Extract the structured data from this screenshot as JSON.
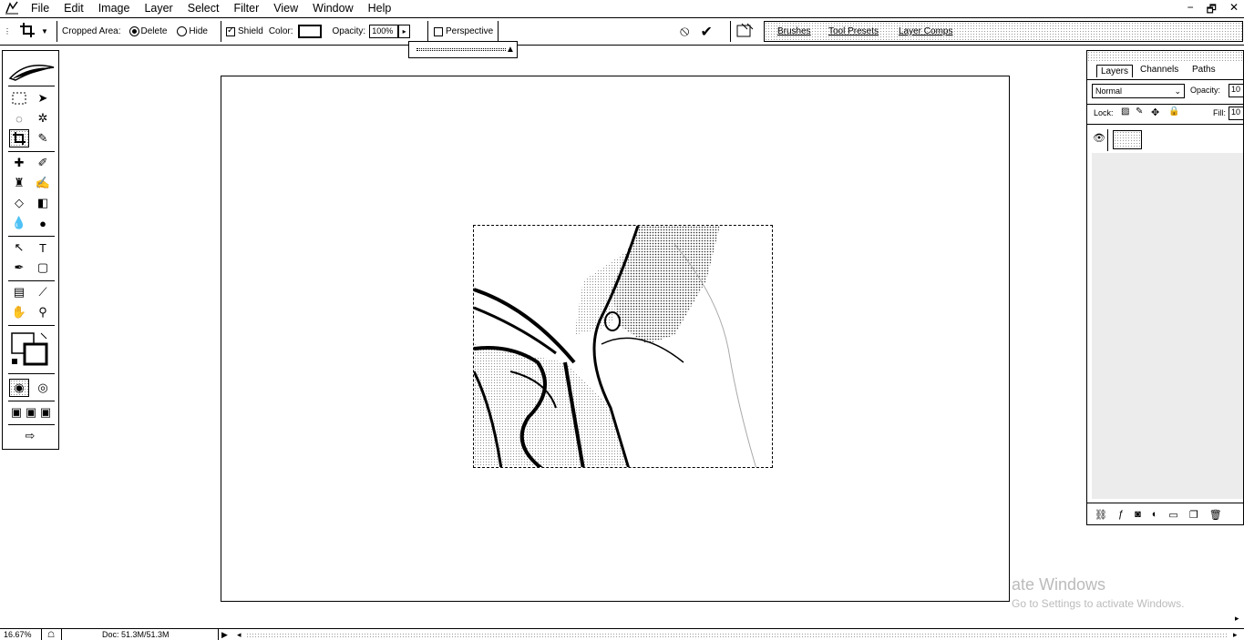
{
  "menubar": {
    "items": [
      "File",
      "Edit",
      "Image",
      "Layer",
      "Select",
      "Filter",
      "View",
      "Window",
      "Help"
    ],
    "window_controls": {
      "minimize": "−",
      "restore": "🗗",
      "close": "✕"
    }
  },
  "options_bar": {
    "cropped_area_label": "Cropped Area:",
    "delete_label": "Delete",
    "hide_label": "Hide",
    "cropped_area_selected": "Delete",
    "shield_label": "Shield",
    "shield_checked": true,
    "color_label": "Color:",
    "color_value": "#000000",
    "opacity_label": "Opacity:",
    "opacity_value": "100%",
    "perspective_label": "Perspective",
    "perspective_checked": false,
    "cancel_icon": "⦸",
    "commit_icon": "✔"
  },
  "palette_well": {
    "tabs": [
      "Brushes",
      "Tool Presets",
      "Layer Comps"
    ]
  },
  "layers_panel": {
    "tabs": [
      "Layers",
      "Channels",
      "Paths"
    ],
    "blend_mode": "Normal",
    "opacity_label": "Opacity:",
    "opacity_value": "10",
    "lock_label": "Lock:",
    "fill_label": "Fill:",
    "fill_value": "10"
  },
  "watermark": {
    "title": "ate Windows",
    "subtitle": "Go to Settings to activate Windows."
  },
  "status_bar": {
    "zoom": "16.67%",
    "doc": "Doc: 51.3M/51.3M"
  }
}
